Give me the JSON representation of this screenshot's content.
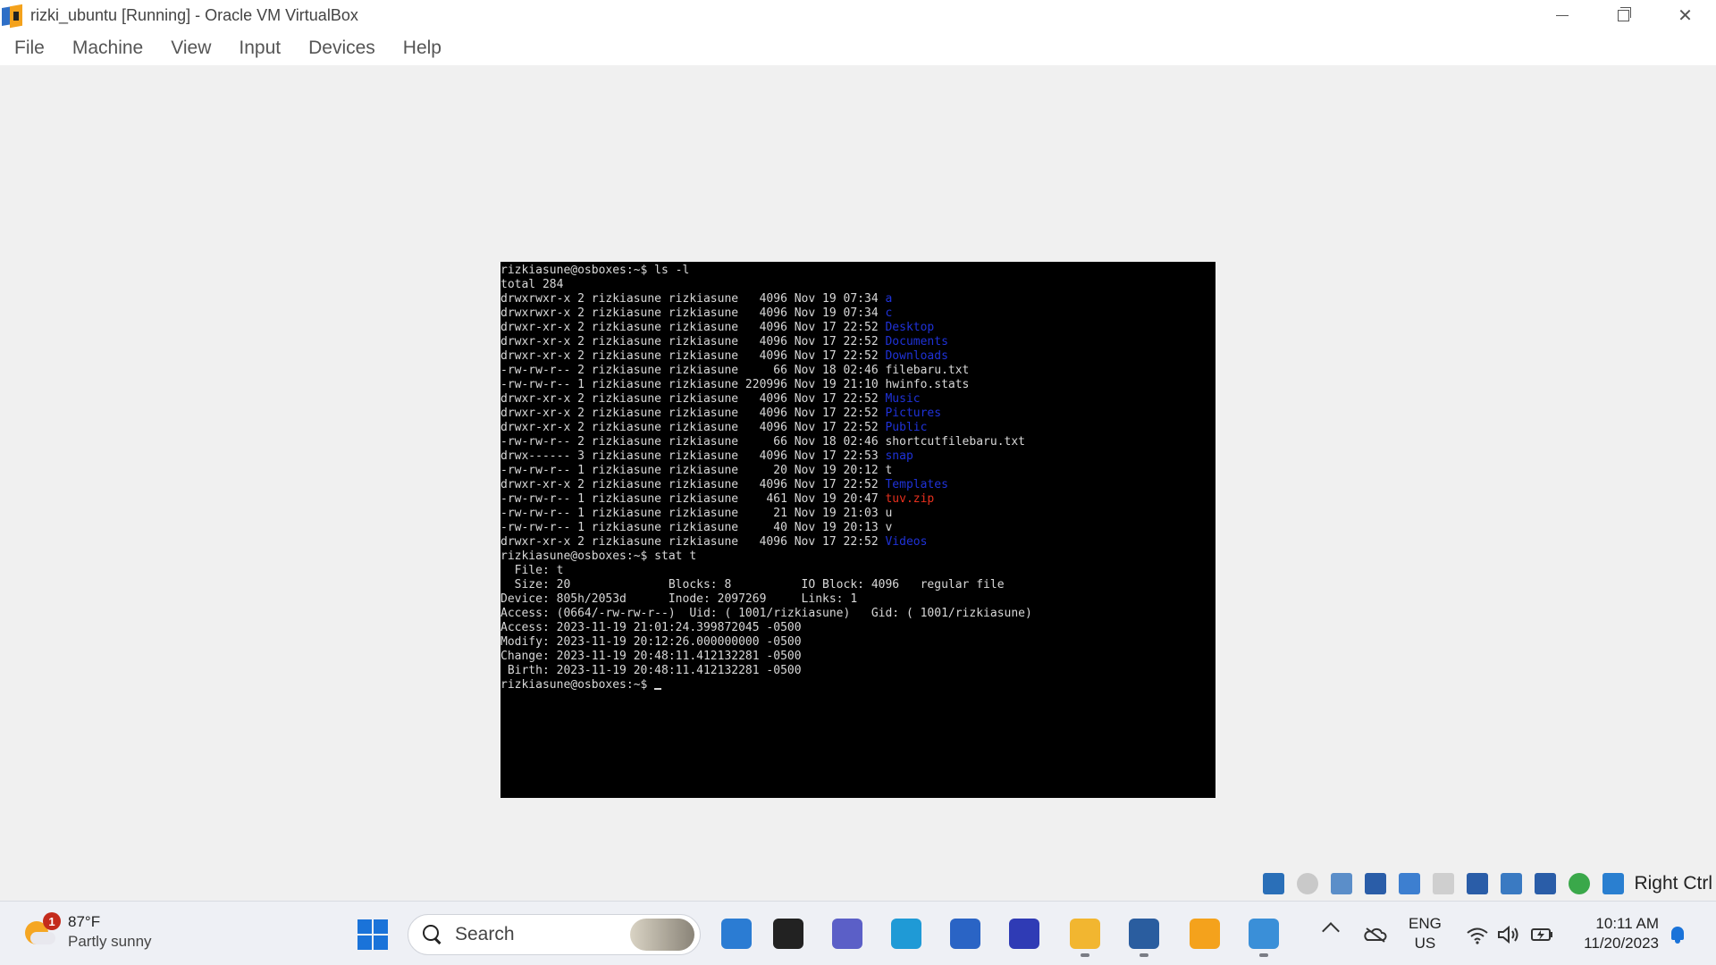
{
  "window": {
    "title": "rizki_ubuntu [Running] - Oracle VM VirtualBox",
    "icon": "virtualbox-icon"
  },
  "menu": [
    "File",
    "Machine",
    "View",
    "Input",
    "Devices",
    "Help"
  ],
  "terminal": {
    "prompt": "rizkiasune@osboxes:~$",
    "lines": [
      {
        "text": "rizkiasune@osboxes:~$ ls -l"
      },
      {
        "text": "total 284"
      },
      {
        "text": "drwxrwxr-x 2 rizkiasune rizkiasune   4096 Nov 19 07:34 ",
        "name": "a",
        "kind": "dir"
      },
      {
        "text": "drwxrwxr-x 2 rizkiasune rizkiasune   4096 Nov 19 07:34 ",
        "name": "c",
        "kind": "dir"
      },
      {
        "text": "drwxr-xr-x 2 rizkiasune rizkiasune   4096 Nov 17 22:52 ",
        "name": "Desktop",
        "kind": "dir"
      },
      {
        "text": "drwxr-xr-x 2 rizkiasune rizkiasune   4096 Nov 17 22:52 ",
        "name": "Documents",
        "kind": "dir"
      },
      {
        "text": "drwxr-xr-x 2 rizkiasune rizkiasune   4096 Nov 17 22:52 ",
        "name": "Downloads",
        "kind": "dir"
      },
      {
        "text": "-rw-rw-r-- 2 rizkiasune rizkiasune     66 Nov 18 02:46 ",
        "name": "filebaru.txt",
        "kind": "file"
      },
      {
        "text": "-rw-rw-r-- 1 rizkiasune rizkiasune 220996 Nov 19 21:10 ",
        "name": "hwinfo.stats",
        "kind": "file"
      },
      {
        "text": "drwxr-xr-x 2 rizkiasune rizkiasune   4096 Nov 17 22:52 ",
        "name": "Music",
        "kind": "dir"
      },
      {
        "text": "drwxr-xr-x 2 rizkiasune rizkiasune   4096 Nov 17 22:52 ",
        "name": "Pictures",
        "kind": "dir"
      },
      {
        "text": "drwxr-xr-x 2 rizkiasune rizkiasune   4096 Nov 17 22:52 ",
        "name": "Public",
        "kind": "dir"
      },
      {
        "text": "-rw-rw-r-- 2 rizkiasune rizkiasune     66 Nov 18 02:46 ",
        "name": "shortcutfilebaru.txt",
        "kind": "file"
      },
      {
        "text": "drwx------ 3 rizkiasune rizkiasune   4096 Nov 17 22:53 ",
        "name": "snap",
        "kind": "dir"
      },
      {
        "text": "-rw-rw-r-- 1 rizkiasune rizkiasune     20 Nov 19 20:12 ",
        "name": "t",
        "kind": "file"
      },
      {
        "text": "drwxr-xr-x 2 rizkiasune rizkiasune   4096 Nov 17 22:52 ",
        "name": "Templates",
        "kind": "dir"
      },
      {
        "text": "-rw-rw-r-- 1 rizkiasune rizkiasune    461 Nov 19 20:47 ",
        "name": "tuv.zip",
        "kind": "zip"
      },
      {
        "text": "-rw-rw-r-- 1 rizkiasune rizkiasune     21 Nov 19 21:03 ",
        "name": "u",
        "kind": "file"
      },
      {
        "text": "-rw-rw-r-- 1 rizkiasune rizkiasune     40 Nov 19 20:13 ",
        "name": "v",
        "kind": "file"
      },
      {
        "text": "drwxr-xr-x 2 rizkiasune rizkiasune   4096 Nov 17 22:52 ",
        "name": "Videos",
        "kind": "dir"
      },
      {
        "text": "rizkiasune@osboxes:~$ stat t"
      },
      {
        "text": "  File: t"
      },
      {
        "text": "  Size: 20              Blocks: 8          IO Block: 4096   regular file"
      },
      {
        "text": "Device: 805h/2053d      Inode: 2097269     Links: 1"
      },
      {
        "text": "Access: (0664/-rw-rw-r--)  Uid: ( 1001/rizkiasune)   Gid: ( 1001/rizkiasune)"
      },
      {
        "text": "Access: 2023-11-19 21:01:24.399872045 -0500"
      },
      {
        "text": "Modify: 2023-11-19 20:12:26.000000000 -0500"
      },
      {
        "text": "Change: 2023-11-19 20:48:11.412132281 -0500"
      },
      {
        "text": " Birth: 2023-11-19 20:48:11.412132281 -0500"
      }
    ]
  },
  "status_bar": {
    "icons": [
      "hard-disk-icon",
      "optical-drive-icon",
      "audio-icon",
      "network-icon",
      "usb-icon",
      "shared-folders-icon",
      "display-icon",
      "recording-icon",
      "vt-x-icon",
      "mouse-integration-icon",
      "keyboard-capture-icon"
    ],
    "host_key": "Right Ctrl"
  },
  "taskbar": {
    "weather": {
      "badge": "1",
      "temp": "87°F",
      "condition": "Partly sunny"
    },
    "search_label": "Search",
    "apps": [
      {
        "name": "outlook-preview-app",
        "color": "#2b7cd3"
      },
      {
        "name": "task-view-app",
        "color": "#222222"
      },
      {
        "name": "teams-chat-app",
        "color": "#5b5fc7"
      },
      {
        "name": "edge-browser-app",
        "color": "#1f9ad6"
      },
      {
        "name": "microsoft-store-app",
        "color": "#2a64c5"
      },
      {
        "name": "antivirus-app",
        "color": "#2f3bb5"
      },
      {
        "name": "file-explorer-app",
        "color": "#f2b630"
      },
      {
        "name": "virtualbox-cube-app",
        "color": "#2a5d9f"
      },
      {
        "name": "virtualbox-app",
        "color": "#f4a21c"
      },
      {
        "name": "photos-app",
        "color": "#3a8fd8"
      }
    ],
    "lang": {
      "line1": "ENG",
      "line2": "US"
    },
    "clock": {
      "time": "10:11 AM",
      "date": "11/20/2023"
    }
  }
}
